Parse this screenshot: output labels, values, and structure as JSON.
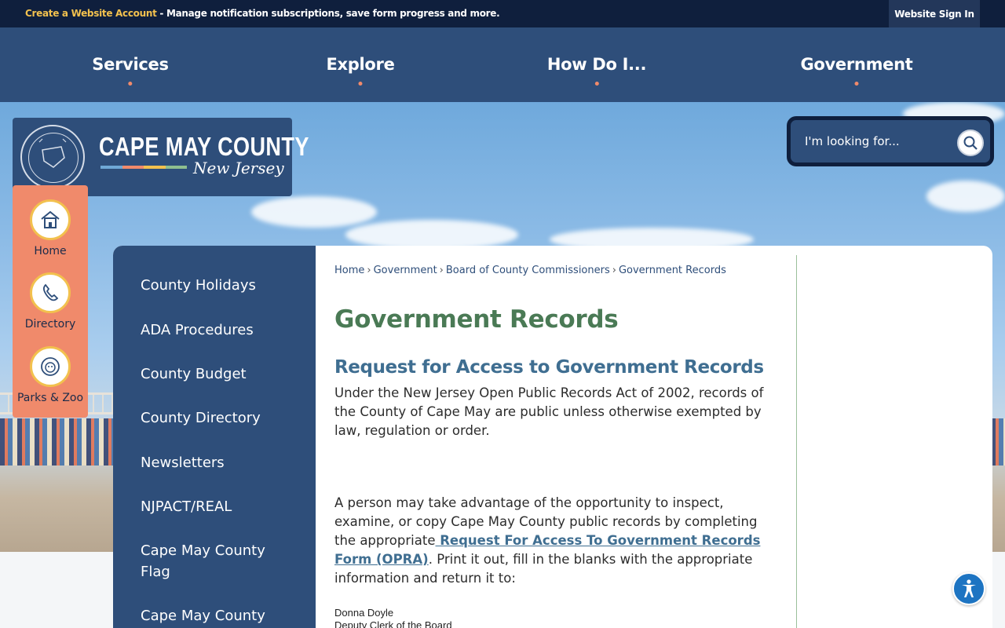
{
  "topbar": {
    "create_account": "Create a Website Account",
    "message": " - Manage notification subscriptions, save form progress and more.",
    "signin": "Website Sign In"
  },
  "nav": [
    {
      "label": "Services"
    },
    {
      "label": "Explore"
    },
    {
      "label": "How Do I..."
    },
    {
      "label": "Government"
    }
  ],
  "logo": {
    "title": "CAPE MAY COUNTY",
    "subtitle": "New Jersey",
    "stripe_colors": [
      "#6fa8d6",
      "#f08a6b",
      "#f2c14e",
      "#8fbf8f"
    ]
  },
  "quick_links": [
    {
      "label": "Home",
      "icon": "house-icon"
    },
    {
      "label": "Directory",
      "icon": "phone-icon"
    },
    {
      "label": "Parks & Zoo",
      "icon": "lion-icon"
    }
  ],
  "search": {
    "placeholder": "I'm looking for...",
    "icon": "search-icon"
  },
  "sidebar": {
    "items": [
      {
        "label": "County Holidays"
      },
      {
        "label": "ADA Procedures"
      },
      {
        "label": "County Budget"
      },
      {
        "label": "County Directory"
      },
      {
        "label": "Newsletters"
      },
      {
        "label": "NJPACT/REAL"
      },
      {
        "label": "Cape May County Flag"
      },
      {
        "label": "Cape May County"
      }
    ]
  },
  "breadcrumb": [
    "Home",
    "Government",
    "Board of County Commissioners",
    "Government Records"
  ],
  "breadcrumb_separator": "›",
  "page": {
    "title": "Government Records",
    "subtitle": "Request for Access to Government Records",
    "para1": "Under the New Jersey Open Public Records Act of 2002, records of the County of Cape May are public unless otherwise exempted by law, regulation or order.",
    "para2_before": "A person may take advantage of the opportunity to inspect, examine, or copy Cape May County public records by completing the appropriate",
    "para2_link": " Request For Access To Government Records Form (OPRA)",
    "para2_after": ". Print it out, fill in the blanks with the appropriate information and return it to:",
    "contact_name": "Donna Doyle",
    "contact_title": "Deputy Clerk of the Board"
  },
  "colors": {
    "navy": "#0f1f3d",
    "nav_blue": "#2e4e7a",
    "coral": "#f08a6b",
    "gold": "#f2c14e",
    "green_title": "#4a7a55",
    "heading_blue": "#3f6e91"
  },
  "accessibility": {
    "icon": "accessibility-icon"
  }
}
